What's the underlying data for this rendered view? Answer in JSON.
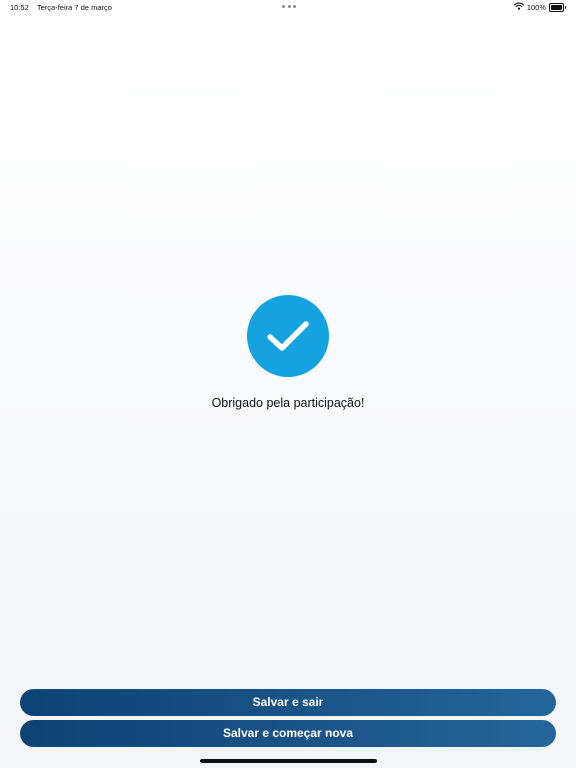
{
  "status_bar": {
    "time": "10:52",
    "date": "Terça-feira 7 de março",
    "battery": "100%",
    "icons": [
      "multitasking-dots-icon",
      "wifi-icon",
      "battery-icon"
    ]
  },
  "confirmation": {
    "icon": "checkmark-icon",
    "icon_color": "#14a3e0",
    "message": "Obrigado pela participação!"
  },
  "actions": {
    "save_exit_label": "Salvar e sair",
    "save_new_label": "Salvar e começar nova",
    "button_color": "#0d4274"
  }
}
